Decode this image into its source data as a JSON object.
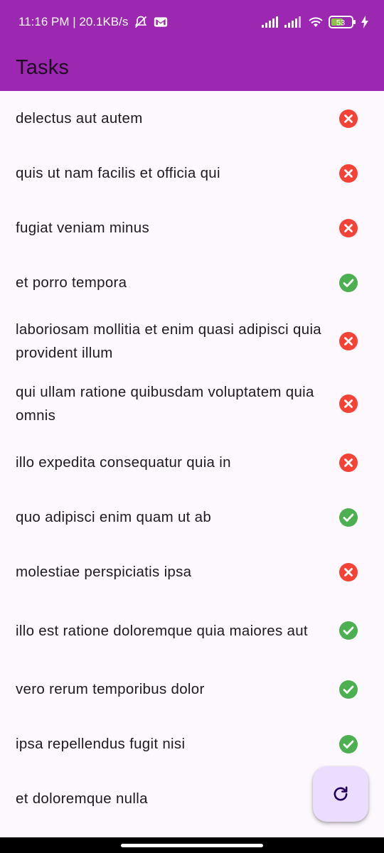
{
  "status_bar": {
    "time": "11:16 PM | 20.1KB/s",
    "battery": "53",
    "icons": [
      "muted-alarm-icon",
      "gmail-icon",
      "signal-icon",
      "signal-icon",
      "wifi-icon",
      "battery-icon",
      "charging-icon"
    ]
  },
  "app_bar": {
    "title": "Tasks"
  },
  "tasks": [
    {
      "title": "delectus aut autem",
      "completed": false
    },
    {
      "title": "quis ut nam facilis et officia qui",
      "completed": false
    },
    {
      "title": "fugiat veniam minus",
      "completed": false
    },
    {
      "title": "et porro tempora",
      "completed": true
    },
    {
      "title": "laboriosam mollitia et enim quasi adipisci quia provident illum",
      "completed": false
    },
    {
      "title": "qui ullam ratione quibusdam voluptatem quia omnis",
      "completed": false
    },
    {
      "title": "illo expedita consequatur quia in",
      "completed": false
    },
    {
      "title": "quo adipisci enim quam ut ab",
      "completed": true
    },
    {
      "title": "molestiae perspiciatis ipsa",
      "completed": false
    },
    {
      "title": "illo est ratione doloremque quia maiores aut",
      "completed": true
    },
    {
      "title": "vero rerum temporibus dolor",
      "completed": true
    },
    {
      "title": "ipsa repellendus fugit nisi",
      "completed": true
    },
    {
      "title": "et doloremque nulla",
      "completed": false
    }
  ],
  "colors": {
    "primary": "#9c27b0",
    "completed": "#4caf50",
    "not_completed": "#f44336",
    "fab": "#eaddff"
  },
  "fab": {
    "icon": "refresh-icon"
  }
}
